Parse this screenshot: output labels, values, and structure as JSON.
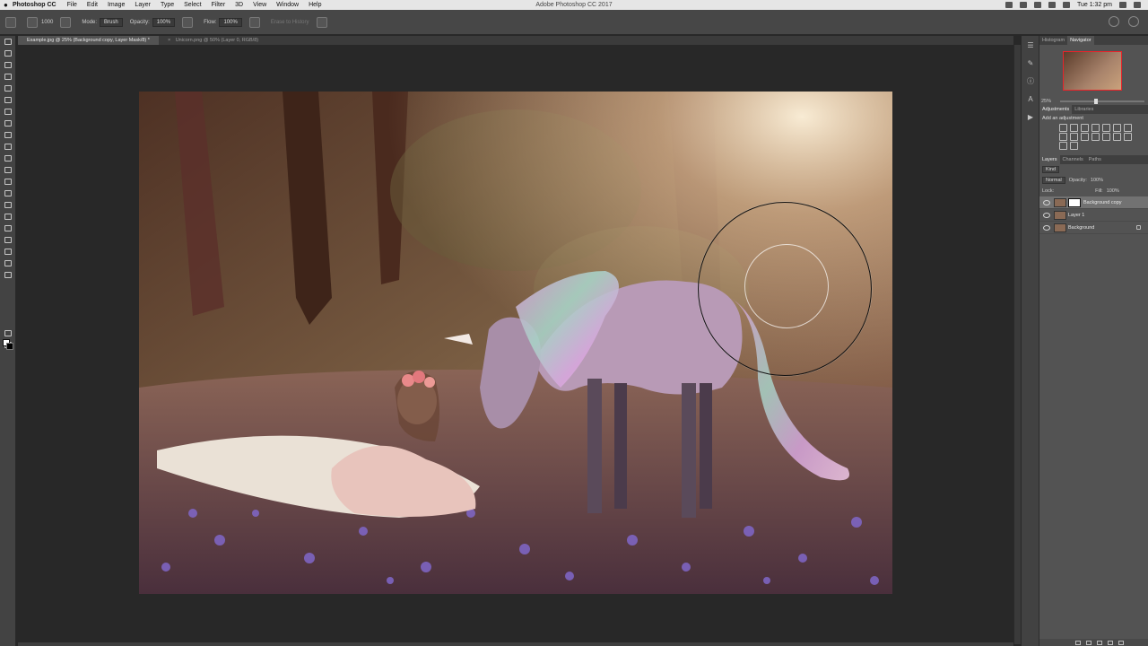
{
  "menubar": {
    "app_name": "Photoshop CC",
    "items": [
      "File",
      "Edit",
      "Image",
      "Layer",
      "Type",
      "Select",
      "Filter",
      "3D",
      "View",
      "Window",
      "Help"
    ],
    "window_title": "Adobe Photoshop CC 2017",
    "clock": "Tue 1:32 pm"
  },
  "options": {
    "brush_size": "1000",
    "mode_label": "Mode:",
    "mode_value": "Brush",
    "opacity_label": "Opacity:",
    "opacity_value": "100%",
    "flow_label": "Flow:",
    "flow_value": "100%",
    "erase_history": "Erase to History"
  },
  "tabs": [
    {
      "label": "Example.jpg @ 25% (Background copy, Layer Mask/8) *",
      "active": true
    },
    {
      "label": "Unicorn.png @ 50% (Layer 0, RGB/8)",
      "active": false
    }
  ],
  "panels": {
    "histogram_tab": "Histogram",
    "navigator_tab": "Navigator",
    "zoom": "25%",
    "adjustments_tab": "Adjustments",
    "libraries_tab": "Libraries",
    "add_adjustment": "Add an adjustment",
    "layers_tab": "Layers",
    "channels_tab": "Channels",
    "paths_tab": "Paths",
    "kind": "Kind",
    "blend_mode": "Normal",
    "opacity_label": "Opacity:",
    "opacity_value": "100%",
    "lock_label": "Lock:",
    "fill_label": "Fill:",
    "fill_value": "100%",
    "layers": [
      {
        "name": "Background copy",
        "selected": true,
        "has_mask": true
      },
      {
        "name": "Layer 1",
        "selected": false,
        "has_mask": false
      },
      {
        "name": "Background",
        "selected": false,
        "has_mask": false,
        "locked": true
      }
    ]
  },
  "colors": {
    "background": "#282828",
    "panel": "#535353",
    "nav_frame": "#e8232a"
  }
}
